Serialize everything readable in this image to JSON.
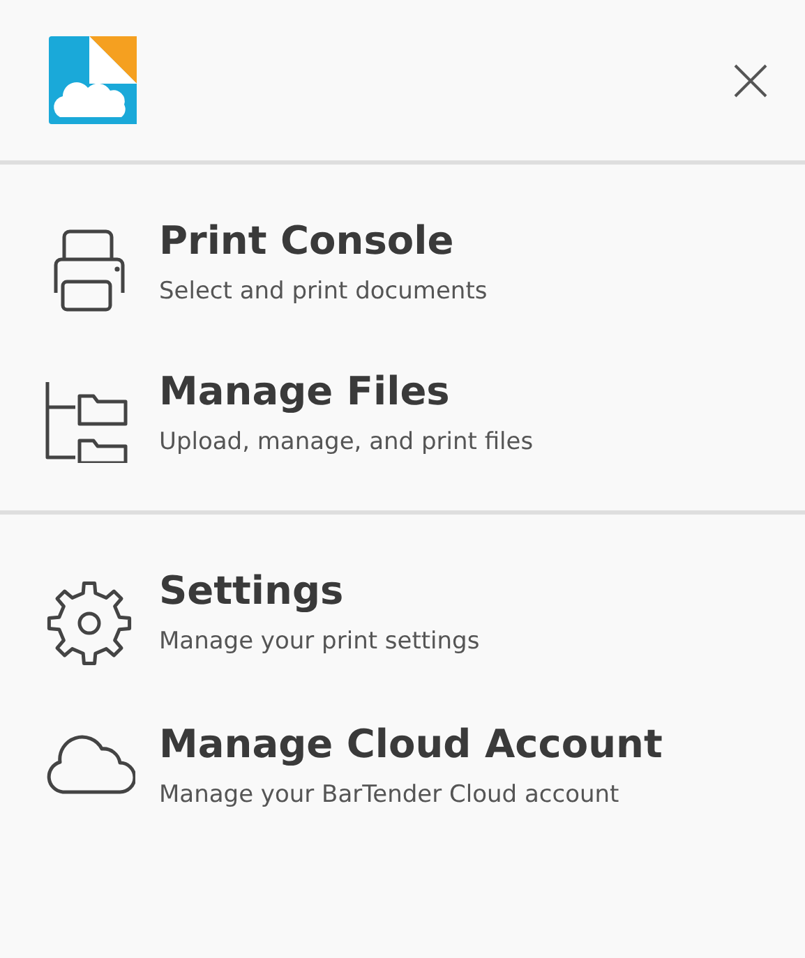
{
  "sections": [
    {
      "items": [
        {
          "kind": "printer",
          "title": "Print Console",
          "subtitle": "Select and print documents"
        },
        {
          "kind": "folders",
          "title": "Manage Files",
          "subtitle": "Upload, manage, and print files"
        }
      ]
    },
    {
      "items": [
        {
          "kind": "gear",
          "title": "Settings",
          "subtitle": "Manage your print settings"
        },
        {
          "kind": "cloud",
          "title": "Manage Cloud Account",
          "subtitle": "Manage your BarTender Cloud account"
        }
      ]
    }
  ]
}
